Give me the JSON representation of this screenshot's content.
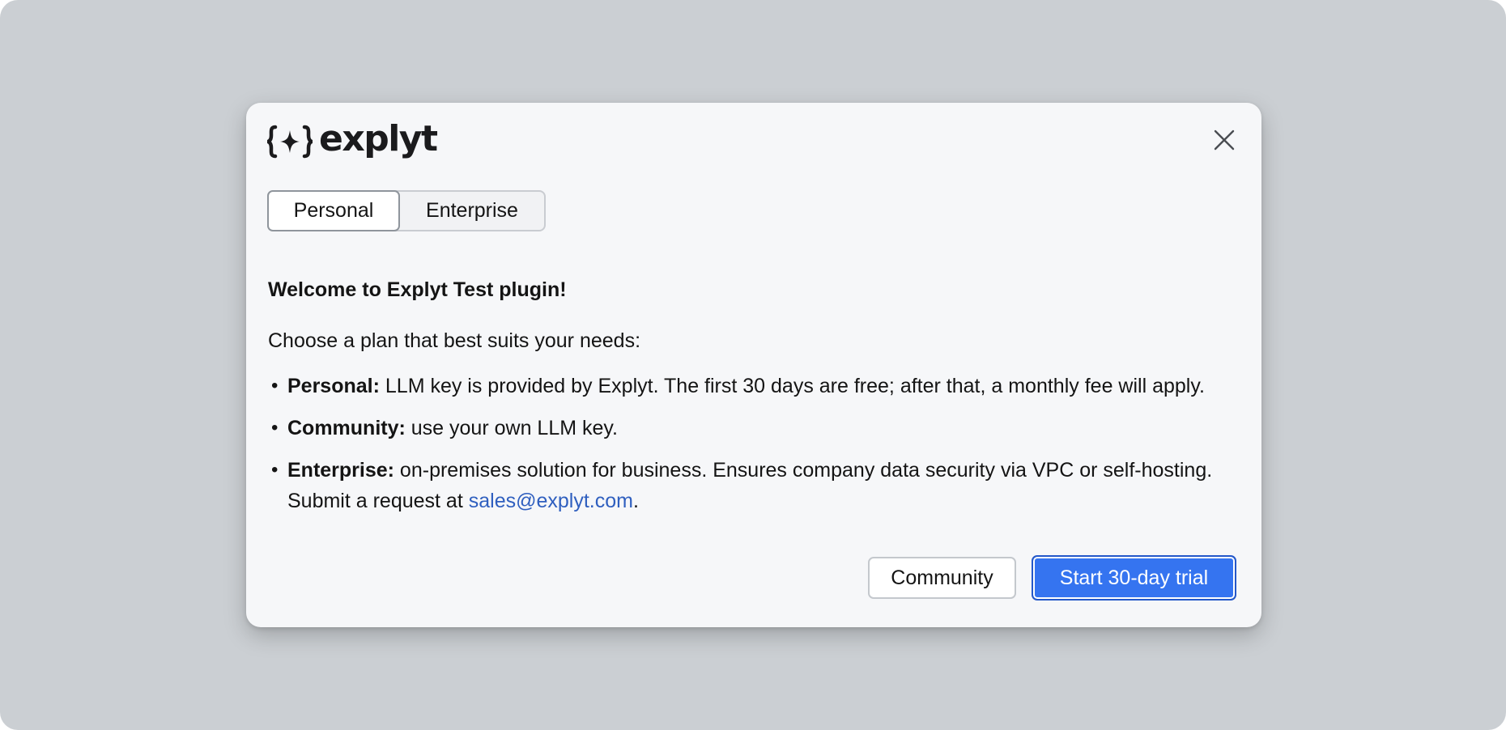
{
  "brand": {
    "name": "explyt",
    "logo_icon": "braces-sparkle-icon"
  },
  "dialog": {
    "close_icon": "close-icon",
    "tabs": [
      {
        "label": "Personal",
        "selected": true
      },
      {
        "label": "Enterprise",
        "selected": false
      }
    ],
    "heading": "Welcome to Explyt Test plugin!",
    "intro": "Choose a plan that best suits your needs:",
    "plans": [
      {
        "term": "Personal:",
        "description": " LLM key is provided by Explyt. The first 30 days are free; after that, a monthly fee will apply."
      },
      {
        "term": "Community:",
        "description": " use your own LLM key."
      },
      {
        "term": "Enterprise:",
        "description": " on-premises solution for business. Ensures company data security via VPC or self-hosting. Submit a request at ",
        "link": "sales@explyt.com",
        "suffix": "."
      }
    ],
    "buttons": {
      "secondary_label": "Community",
      "primary_label": "Start 30-day trial"
    }
  },
  "colors": {
    "backdrop": "#cbcfd3",
    "dialog": "#f6f7f9",
    "primary": "#3574f0",
    "link": "#2f5fbf"
  }
}
